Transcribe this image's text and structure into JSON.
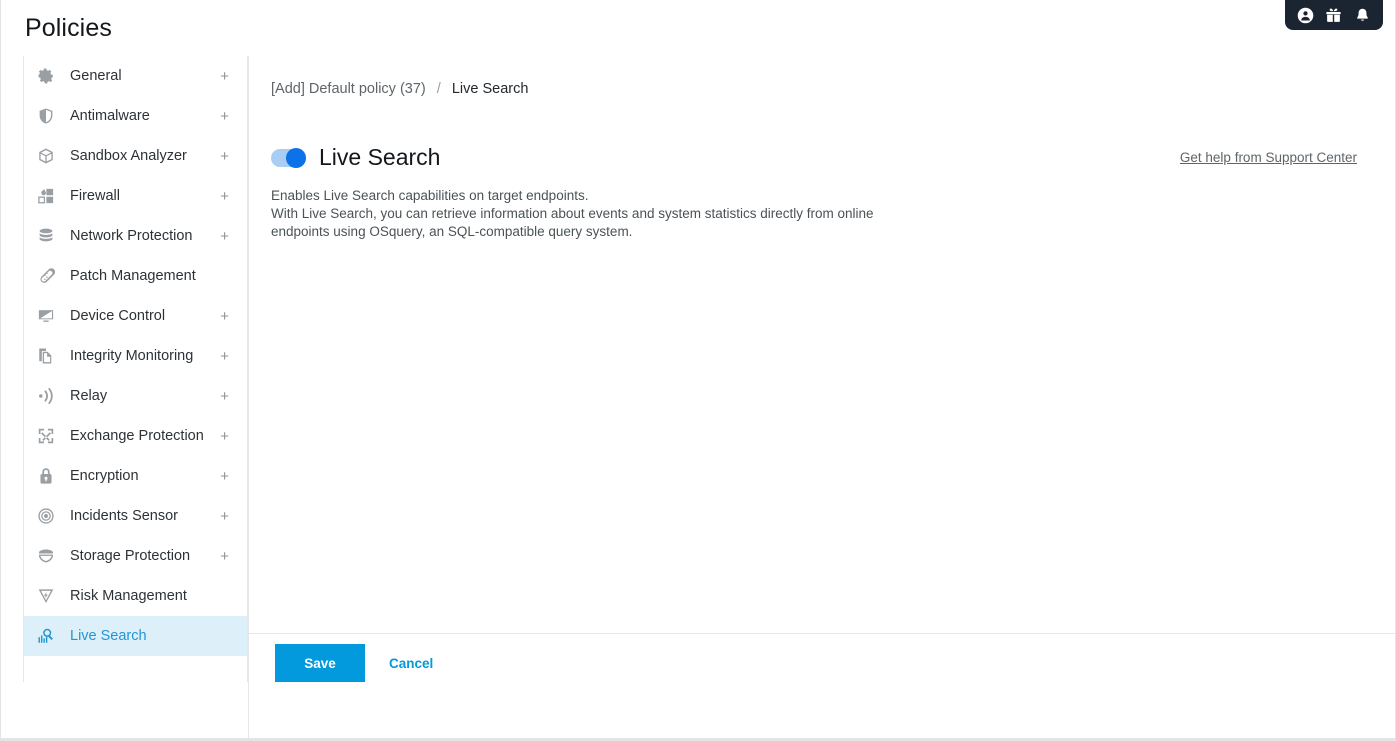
{
  "page": {
    "title": "Policies"
  },
  "topbar": {
    "icons": [
      {
        "name": "account-icon"
      },
      {
        "name": "gift-icon"
      },
      {
        "name": "bell-icon"
      }
    ]
  },
  "sidebar": {
    "items": [
      {
        "label": "General",
        "icon": "gear-icon",
        "expandable": "+",
        "active": false
      },
      {
        "label": "Antimalware",
        "icon": "shield-icon",
        "expandable": "+",
        "active": false
      },
      {
        "label": "Sandbox Analyzer",
        "icon": "cube-icon",
        "expandable": "+",
        "active": false
      },
      {
        "label": "Firewall",
        "icon": "firewall-blocks-icon",
        "expandable": "+",
        "active": false
      },
      {
        "label": "Network Protection",
        "icon": "database-stack-icon",
        "expandable": "+",
        "active": false
      },
      {
        "label": "Patch Management",
        "icon": "bandage-icon",
        "expandable": "",
        "active": false
      },
      {
        "label": "Device Control",
        "icon": "monitor-icon",
        "expandable": "+",
        "active": false
      },
      {
        "label": "Integrity Monitoring",
        "icon": "copy-pages-icon",
        "expandable": "+",
        "active": false
      },
      {
        "label": "Relay",
        "icon": "broadcast-icon",
        "expandable": "+",
        "active": false
      },
      {
        "label": "Exchange Protection",
        "icon": "exchange-arrows-icon",
        "expandable": "+",
        "active": false
      },
      {
        "label": "Encryption",
        "icon": "lock-icon",
        "expandable": "+",
        "active": false
      },
      {
        "label": "Incidents Sensor",
        "icon": "radar-target-icon",
        "expandable": "+",
        "active": false
      },
      {
        "label": "Storage Protection",
        "icon": "storage-shield-icon",
        "expandable": "+",
        "active": false
      },
      {
        "label": "Risk Management",
        "icon": "risk-bolt-icon",
        "expandable": "",
        "active": false
      },
      {
        "label": "Live Search",
        "icon": "live-search-icon",
        "expandable": "",
        "active": true
      }
    ]
  },
  "breadcrumb": {
    "parent": "[Add] Default policy (37)",
    "separator": "/",
    "current": "Live Search"
  },
  "main": {
    "toggle_state": "on",
    "section_title": "Live Search",
    "help_link": "Get help from Support Center",
    "description_line_1": "Enables Live Search capabilities on target endpoints.",
    "description_line_2": "With Live Search, you can retrieve information about events and system statistics directly from online endpoints using OSquery, an SQL-compatible query system."
  },
  "footer": {
    "save_label": "Save",
    "cancel_label": "Cancel"
  },
  "colors": {
    "accent_blue": "#029add",
    "toggle_knob": "#0b72e8",
    "toggle_track": "#a9cdf3",
    "active_item_bg": "#ddf0fa",
    "active_item_text": "#2196d3",
    "topbar_dark": "#1b2431"
  }
}
